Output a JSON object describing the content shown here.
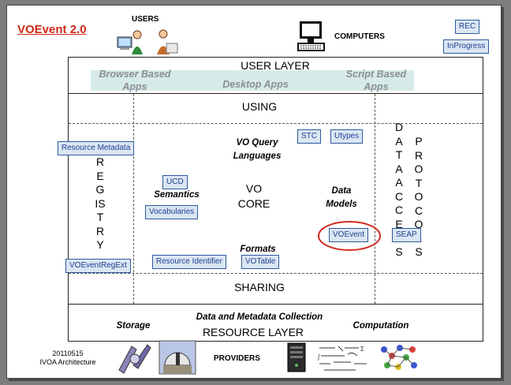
{
  "header": {
    "title_prefix": "VOEvent",
    "title_version": "2.0",
    "users_label": "USERS",
    "computers_label": "COMPUTERS",
    "status_rec": "REC",
    "status_inprogress": "InProgress"
  },
  "layers": {
    "user_layer": "USER LAYER",
    "browser_apps": "Browser Based Apps",
    "desktop_apps": "Desktop Apps",
    "script_apps": "Script Based Apps",
    "using": "USING",
    "sharing": "SHARING",
    "resource_layer": "RESOURCE LAYER",
    "storage": "Storage",
    "computation": "Computation",
    "collection": "Data and Metadata Collection"
  },
  "core": {
    "vo_core": "VO CORE",
    "query_languages": "VO Query Languages",
    "semantics": "Semantics",
    "data_models": "Data Models",
    "formats": "Formats"
  },
  "vertical": {
    "registry": "REGISTRY",
    "data_access": "DATA ACCESS",
    "protocols": "PROTOCOLS"
  },
  "standards": {
    "resource_metadata": "Resource Metadata",
    "stc": "STC",
    "utypes": "Utypes",
    "ucd": "UCD",
    "vocabularies": "Vocabularies",
    "voevent": "VOEvent",
    "seap": "SEAP",
    "resource_identifier": "Resource Identifier",
    "votable": "VOTable",
    "voeventregext": "VOEventRegExt"
  },
  "footer": {
    "date": "20110515",
    "caption": "IVOA Architecture",
    "providers": "PROVIDERS"
  },
  "colors": {
    "title": "#cc2a1a",
    "tag_fill": "#dbe6f3",
    "tag_border": "#2d5a9c",
    "tag_text": "#1e3f92",
    "highlight_ellipse": "#d02a1e"
  }
}
